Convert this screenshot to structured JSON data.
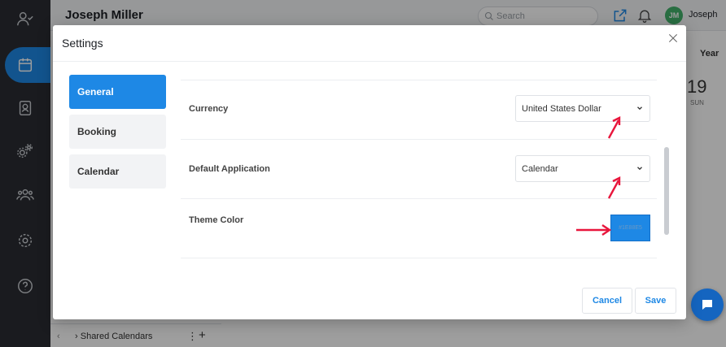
{
  "app": {
    "user_name": "Joseph Miller",
    "search_placeholder": "Search",
    "avatar_initials": "JM",
    "avatar_name": "Joseph"
  },
  "calendar": {
    "view_label": "Year",
    "day_number": "19",
    "day_of_week": "SUN",
    "shared_calendars_label": "Shared Calendars",
    "more_glyph": "⋮",
    "add_glyph": "+"
  },
  "settings": {
    "title": "Settings",
    "nav": [
      {
        "label": "General",
        "active": true
      },
      {
        "label": "Booking",
        "active": false
      },
      {
        "label": "Calendar",
        "active": false
      }
    ],
    "fields": {
      "currency_label": "Currency",
      "currency_value": "United States Dollar",
      "default_app_label": "Default Application",
      "default_app_value": "Calendar",
      "theme_color_label": "Theme Color",
      "theme_color_value": "#1E88E5"
    },
    "cancel_label": "Cancel",
    "save_label": "Save"
  },
  "colors": {
    "accent": "#1e88e5",
    "sidebar": "#2a2d33",
    "annotation": "#e8163c"
  },
  "icons": {
    "rail": [
      "user-check-icon",
      "calendar-icon",
      "contact-icon",
      "gears-icon",
      "people-icon",
      "settings-icon",
      "help-icon"
    ],
    "topbar": [
      "search-icon",
      "external-link-icon",
      "bell-icon",
      "chevron-down-icon"
    ],
    "modal": [
      "close-icon",
      "chevron-down-icon"
    ],
    "fab": "chat-icon"
  }
}
